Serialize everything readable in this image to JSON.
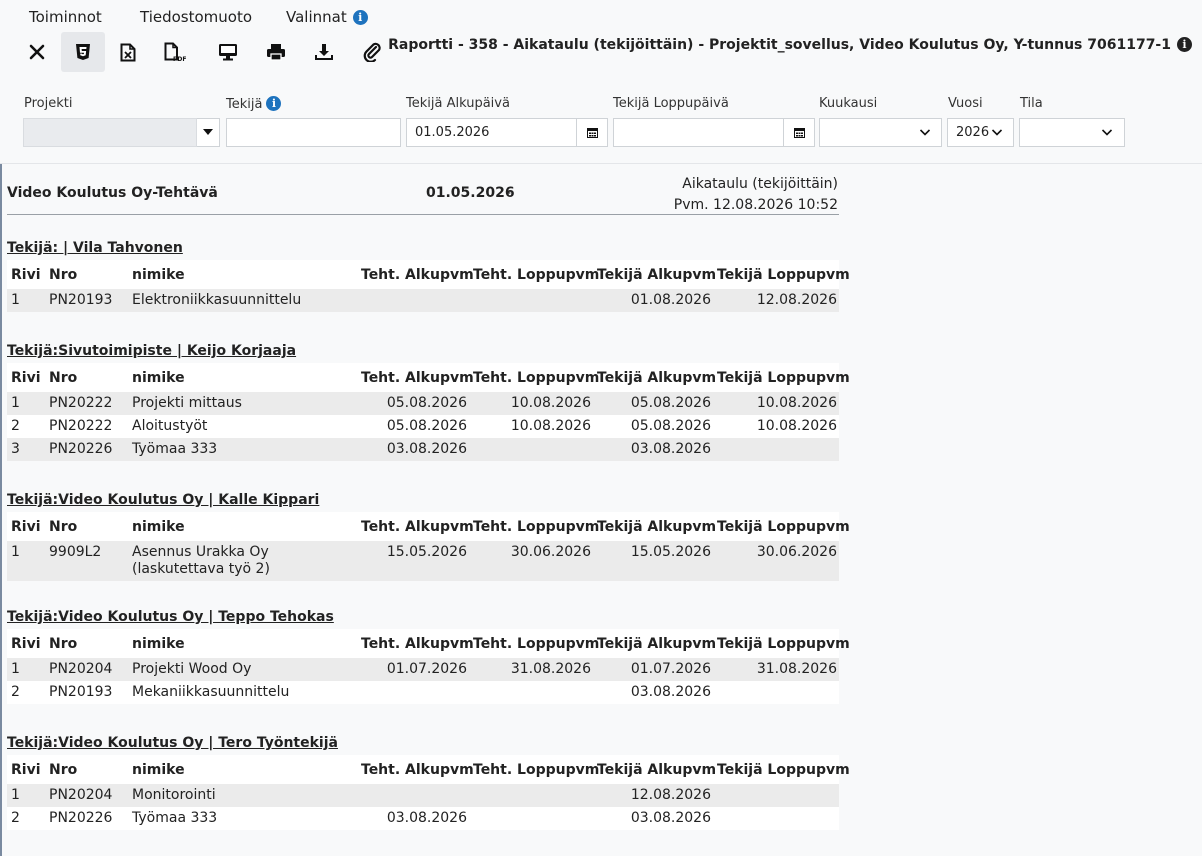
{
  "menu": {
    "toiminnot": "Toiminnot",
    "tiedostomuoto": "Tiedostomuoto",
    "valinnat": "Valinnat"
  },
  "header": {
    "title": "Raportti - 358 - Aikataulu (tekijöittäin) - Projektit_sovellus, Video Koulutus Oy, Y-tunnus 7061177-1"
  },
  "filters": {
    "projekti_label": "Projekti",
    "tekija_label": "Tekijä",
    "alkupaiva_label": "Tekijä Alkupäivä",
    "alkupaiva_value": "01.05.2026",
    "loppupaiva_label": "Tekijä Loppupäivä",
    "kuukausi_label": "Kuukausi",
    "vuosi_label": "Vuosi",
    "vuosi_value": "2026",
    "tila_label": "Tila"
  },
  "report": {
    "company": "Video Koulutus Oy-Tehtävä",
    "date": "01.05.2026",
    "dash": "-",
    "report_name": "Aikataulu (tekijöittäin)",
    "printed": "Pvm. 12.08.2026 10:52",
    "columns": [
      "Rivi",
      "Nro",
      "nimike",
      "Teht. Alkupvm",
      "Teht. Loppupvm",
      "Tekijä Alkupvm",
      "Tekijä Loppupvm"
    ],
    "sections": [
      {
        "title": "Tekijä: | Vila Tahvonen",
        "rows": [
          [
            "1",
            "PN20193",
            "Elektroniikkasuunnittelu",
            "",
            "",
            "01.08.2026",
            "12.08.2026"
          ]
        ]
      },
      {
        "title": "Tekijä:Sivutoimipiste | Keijo Korjaaja",
        "rows": [
          [
            "1",
            "PN20222",
            "Projekti mittaus",
            "05.08.2026",
            "10.08.2026",
            "05.08.2026",
            "10.08.2026"
          ],
          [
            "2",
            "PN20222",
            "Aloitustyöt",
            "05.08.2026",
            "10.08.2026",
            "05.08.2026",
            "10.08.2026"
          ],
          [
            "3",
            "PN20226",
            "Työmaa 333",
            "03.08.2026",
            "",
            "03.08.2026",
            ""
          ]
        ]
      },
      {
        "title": "Tekijä:Video Koulutus Oy | Kalle Kippari",
        "rows": [
          [
            "1",
            "9909L2",
            "Asennus Urakka Oy (laskutettava työ 2)",
            "15.05.2026",
            "30.06.2026",
            "15.05.2026",
            "30.06.2026"
          ]
        ]
      },
      {
        "title": "Tekijä:Video Koulutus Oy | Teppo Tehokas",
        "rows": [
          [
            "1",
            "PN20204",
            "Projekti Wood Oy",
            "01.07.2026",
            "31.08.2026",
            "01.07.2026",
            "31.08.2026"
          ],
          [
            "2",
            "PN20193",
            "Mekaniikkasuunnittelu",
            "",
            "",
            "03.08.2026",
            ""
          ]
        ]
      },
      {
        "title": "Tekijä:Video Koulutus Oy | Tero Työntekijä",
        "rows": [
          [
            "1",
            "PN20204",
            "Monitorointi",
            "",
            "",
            "12.08.2026",
            ""
          ],
          [
            "2",
            "PN20226",
            "Työmaa 333",
            "03.08.2026",
            "",
            "03.08.2026",
            ""
          ]
        ]
      }
    ]
  }
}
